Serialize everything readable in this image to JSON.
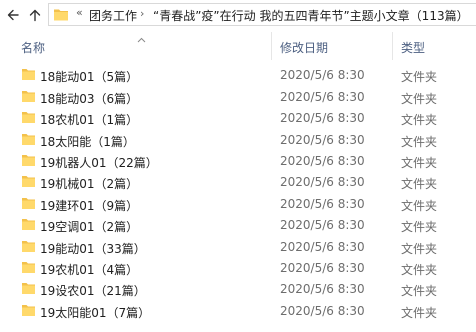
{
  "address_bar": {
    "overflow_glyph": "«",
    "crumbs": [
      "团务工作",
      "“青春战”疫”在行动 我的五四青年节”主题小文章（113篇）"
    ]
  },
  "columns": {
    "name": "名称",
    "date": "修改日期",
    "type": "类型"
  },
  "icons": {
    "back": "back-arrow-icon",
    "up": "up-arrow-icon",
    "folder": "folder-icon",
    "sort": "sort-caret-icon"
  },
  "colors": {
    "folder_body": "#f3c14b",
    "folder_front": "#ffd96b",
    "header_text": "#4d6082"
  },
  "files": [
    {
      "name": "18能动01（5篇）",
      "date": "2020/5/6 8:30",
      "type": "文件夹"
    },
    {
      "name": "18能动03（6篇）",
      "date": "2020/5/6 8:30",
      "type": "文件夹"
    },
    {
      "name": "18农机01（1篇）",
      "date": "2020/5/6 8:30",
      "type": "文件夹"
    },
    {
      "name": "18太阳能（1篇）",
      "date": "2020/5/6 8:30",
      "type": "文件夹"
    },
    {
      "name": "19机器人01（22篇）",
      "date": "2020/5/6 8:30",
      "type": "文件夹"
    },
    {
      "name": "19机械01（2篇）",
      "date": "2020/5/6 8:30",
      "type": "文件夹"
    },
    {
      "name": "19建环01（9篇）",
      "date": "2020/5/6 8:30",
      "type": "文件夹"
    },
    {
      "name": "19空调01（2篇）",
      "date": "2020/5/6 8:30",
      "type": "文件夹"
    },
    {
      "name": "19能动01（33篇）",
      "date": "2020/5/6 8:30",
      "type": "文件夹"
    },
    {
      "name": "19农机01（4篇）",
      "date": "2020/5/6 8:30",
      "type": "文件夹"
    },
    {
      "name": "19设农01（21篇）",
      "date": "2020/5/6 8:30",
      "type": "文件夹"
    },
    {
      "name": "19太阳能01（7篇）",
      "date": "2020/5/6 8:30",
      "type": "文件夹"
    }
  ]
}
